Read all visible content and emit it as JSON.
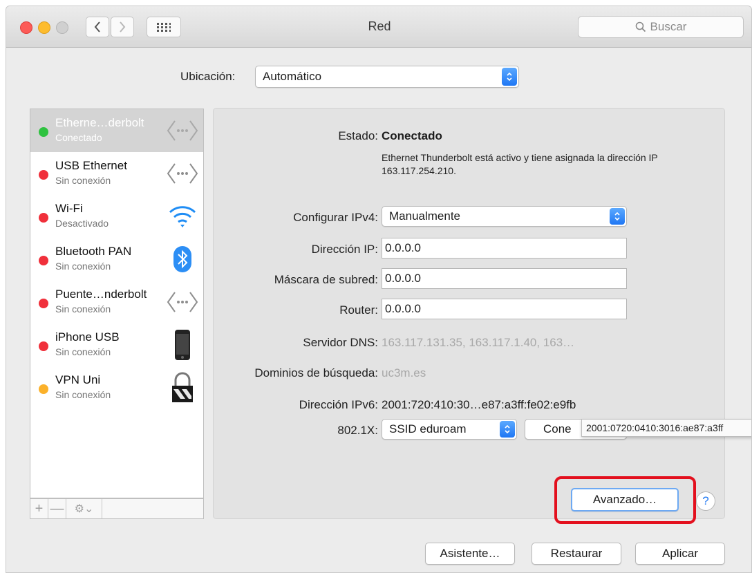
{
  "window": {
    "title": "Red",
    "search_placeholder": "Buscar"
  },
  "location": {
    "label": "Ubicación:",
    "value": "Automático"
  },
  "services": [
    {
      "name": "Etherne…derbolt",
      "status": "Conectado",
      "status_color": "#2fc240",
      "icon": "ethernet-icon",
      "selected": true
    },
    {
      "name": "USB Ethernet",
      "status": "Sin conexión",
      "status_color": "#f0303b",
      "icon": "ethernet-icon"
    },
    {
      "name": "Wi-Fi",
      "status": "Desactivado",
      "status_color": "#f0303b",
      "icon": "wifi-icon"
    },
    {
      "name": "Bluetooth PAN",
      "status": "Sin conexión",
      "status_color": "#f0303b",
      "icon": "bluetooth-icon"
    },
    {
      "name": "Puente…nderbolt",
      "status": "Sin conexión",
      "status_color": "#f0303b",
      "icon": "ethernet-icon"
    },
    {
      "name": "iPhone USB",
      "status": "Sin conexión",
      "status_color": "#f0303b",
      "icon": "iphone-icon"
    },
    {
      "name": "VPN Uni",
      "status": "Sin conexión",
      "status_color": "#fbb12a",
      "icon": "vpn-lock-icon"
    }
  ],
  "sidebar_toolbar": {
    "add": "+",
    "remove": "—",
    "gear": "⚙︎⌄"
  },
  "detail": {
    "estado_label": "Estado:",
    "estado_value": "Conectado",
    "estado_desc": "Ethernet Thunderbolt está activo y tiene asignada la dirección IP 163.117.254.210.",
    "ipv4_label": "Configurar IPv4:",
    "ipv4_value": "Manualmente",
    "ip_label": "Dirección IP:",
    "ip_value": "0.0.0.0",
    "mask_label": "Máscara de subred:",
    "mask_value": "0.0.0.0",
    "router_label": "Router:",
    "router_value": "0.0.0.0",
    "dns_label": "Servidor DNS:",
    "dns_value": "163.117.131.35, 163.117.1.40, 163…",
    "domains_label": "Dominios de búsqueda:",
    "domains_value": "uc3m.es",
    "ipv6_label": "Dirección IPv6:",
    "ipv6_value": "2001:720:410:30…e87:a3ff:fe02:e9fb",
    "dot1x_label": "802.1X:",
    "dot1x_value": "SSID eduroam",
    "connect_button": "Cone",
    "tooltip": "2001:0720:0410:3016:ae87:a3ff",
    "advanced_button": "Avanzado…",
    "help": "?"
  },
  "footer": {
    "assistant": "Asistente…",
    "revert": "Restaurar",
    "apply": "Aplicar"
  },
  "colors": {
    "accent": "#1f77f4",
    "highlight": "#e3101e"
  }
}
